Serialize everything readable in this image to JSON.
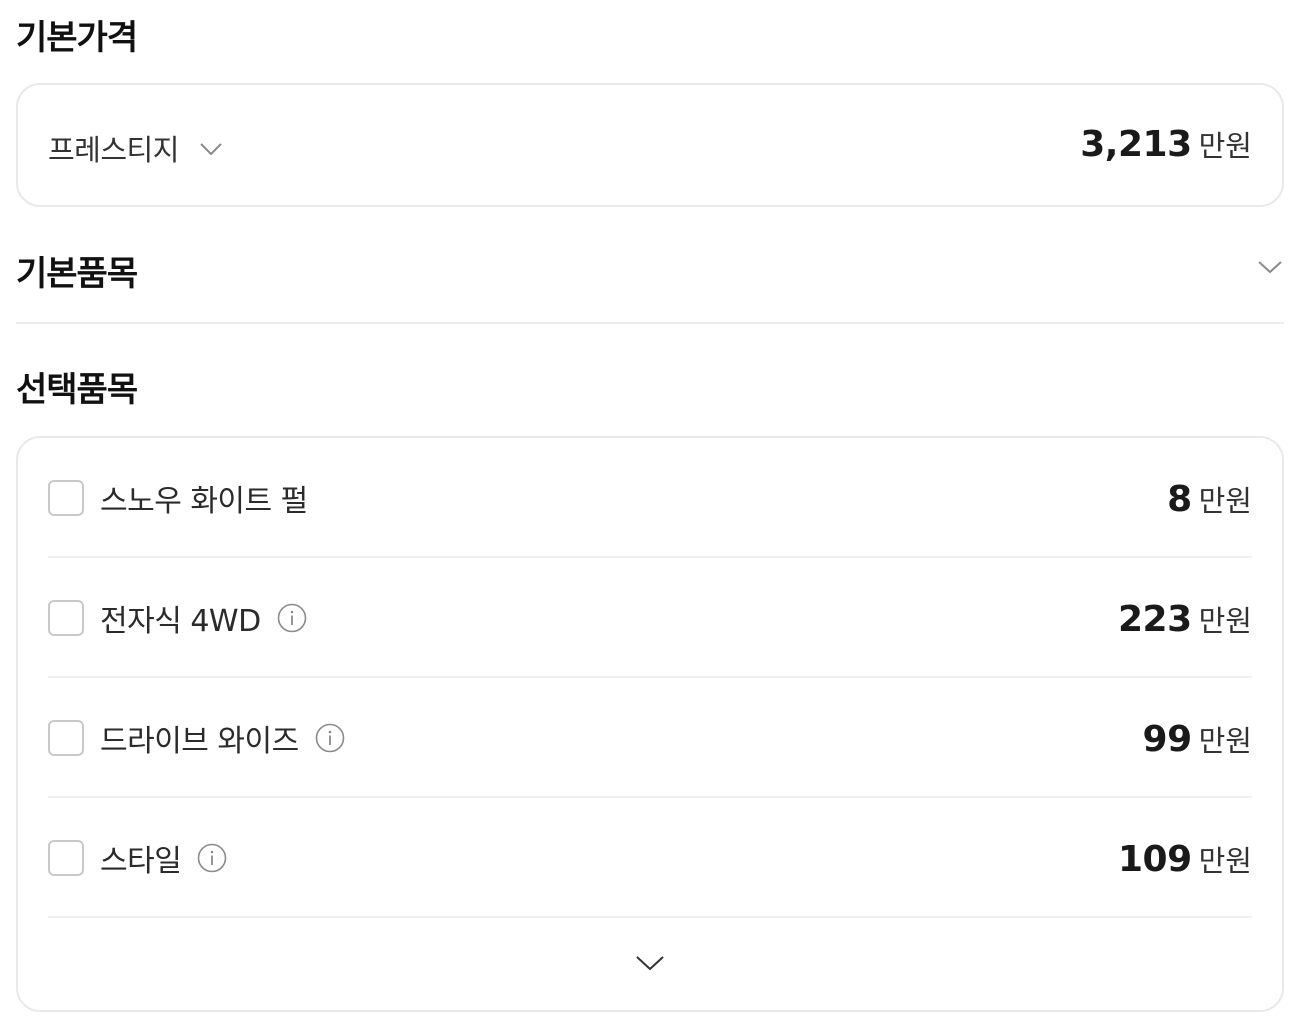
{
  "base_price": {
    "title": "기본가격",
    "trim": "프레스티지",
    "price": "3,213",
    "unit": "만원"
  },
  "base_items": {
    "title": "기본품목"
  },
  "options": {
    "title": "선택품목",
    "items": [
      {
        "label": "스노우 화이트 펄",
        "price": "8",
        "unit": "만원",
        "checked": false,
        "has_info": false
      },
      {
        "label": "전자식 4WD",
        "price": "223",
        "unit": "만원",
        "checked": false,
        "has_info": true
      },
      {
        "label": "드라이브 와이즈",
        "price": "99",
        "unit": "만원",
        "checked": false,
        "has_info": true
      },
      {
        "label": "스타일",
        "price": "109",
        "unit": "만원",
        "checked": false,
        "has_info": true
      }
    ]
  },
  "icons": {
    "trim_dropdown": "chevron-down-icon",
    "base_items_toggle": "chevron-down-icon",
    "info": "info-icon",
    "expand_options": "chevron-down-icon"
  },
  "colors": {
    "text_primary": "#1a1a1a",
    "border": "#e9e9e9",
    "checkbox_border": "#c9c9c9",
    "icon_gray": "#8a8a8a"
  }
}
